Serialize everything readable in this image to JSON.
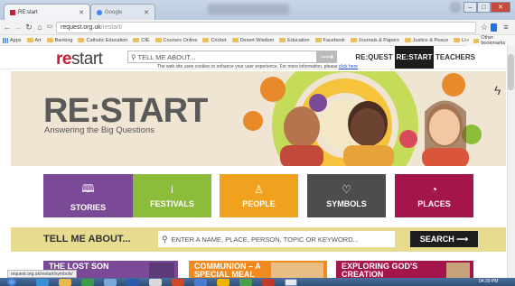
{
  "browser": {
    "active_tab": "RE:start",
    "inactive_tab": "Google",
    "url_host": "request.org.uk",
    "url_path": "/restart/",
    "status_text": "request.org.uk/restart/symbols/",
    "window_controls": [
      "–",
      "□",
      "✕"
    ]
  },
  "bookmarks": {
    "items": [
      "Apps",
      "Art",
      "Banking",
      "Catholic Education",
      "CfE",
      "Courses Online",
      "Cricket",
      "Desert Wisdom",
      "Education",
      "Facebook",
      "Journals & Papers",
      "Justice & Peace",
      "Literature"
    ],
    "overflow": "»",
    "other": "Other bookmarks"
  },
  "site": {
    "logo_re": "re",
    "logo_start": "start",
    "search_placeholder": "TELL ME ABOUT...",
    "search_go": "⟶",
    "nav": [
      "RE:QUEST",
      "RE:START",
      "TEACHERS"
    ],
    "cookie_text": "The web site uses cookies to enhance your user experience. For more information, please",
    "cookie_link": "click here"
  },
  "hero": {
    "title": "RE:START",
    "subtitle": "Answering the Big Questions"
  },
  "categories": [
    {
      "label": "STORIES",
      "icon": "book-icon",
      "glyph": "🕮",
      "color": "#7b4a97"
    },
    {
      "label": "FESTIVALS",
      "icon": "info-icon",
      "glyph": "i",
      "color": "#8bbd3a"
    },
    {
      "label": "PEOPLE",
      "icon": "person-icon",
      "glyph": "♙",
      "color": "#f0a21e"
    },
    {
      "label": "SYMBOLS",
      "icon": "heart-icon",
      "glyph": "♡",
      "color": "#4d4d4f"
    },
    {
      "label": "PLACES",
      "icon": "compass-icon",
      "glyph": "◔",
      "color": "#a3154b"
    }
  ],
  "tell_me": {
    "label": "TELL ME ABOUT...",
    "placeholder": "ENTER A NAME, PLACE, PERSON, TOPIC OR KEYWORD...",
    "button": "SEARCH ⟶"
  },
  "cards": [
    {
      "title": "THE LOST SON",
      "color": "#7b4a97"
    },
    {
      "title": "COMMUNION – A SPECIAL MEAL",
      "color": "#f08a1e"
    },
    {
      "title": "EXPLORING GOD'S CREATION",
      "color": "#a3154b"
    }
  ],
  "taskbar": {
    "clock": "04:29 PM"
  },
  "colors": {
    "accent_red": "#c41e3a",
    "hero_bg": "#efe5d2",
    "tell_bar": "#e6db8e"
  }
}
